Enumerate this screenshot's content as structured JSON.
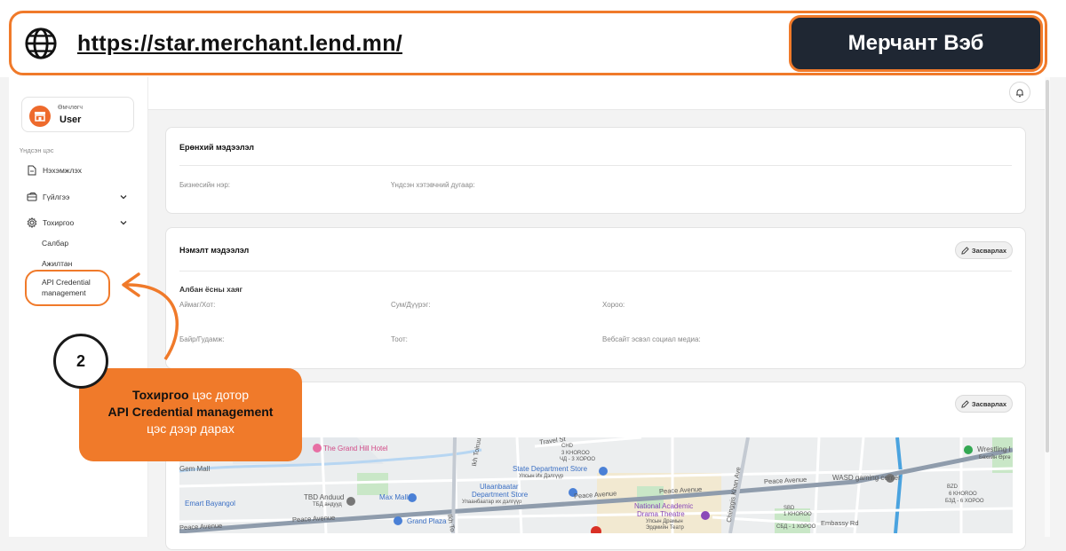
{
  "banner": {
    "url": "https://star.merchant.lend.mn/",
    "badge": "Мерчант Вэб"
  },
  "sidebar": {
    "user_role": "Өмчлөгч",
    "user_name": "User",
    "section": "Үндсэн цэс",
    "items": [
      {
        "label": "Нэхэмжлэх",
        "icon": "document-icon"
      },
      {
        "label": "Гүйлгээ",
        "icon": "wallet-icon"
      },
      {
        "label": "Тохиргоо",
        "icon": "gear-icon"
      }
    ],
    "sub_items": [
      "Салбар",
      "Ажилтан",
      "API Credential management"
    ]
  },
  "general_card": {
    "title": "Ерөнхий мэдээлэл",
    "business_name_label": "Бизнесийн нэр:",
    "registration_label": "Үндсэн хэтэвчний дугаар:"
  },
  "extra_card": {
    "title": "Нэмэлт мэдээлэл",
    "edit_label": "Засварлах",
    "address_title": "Албан ёсны хаяг",
    "province_label": "Аймаг/Хот:",
    "district_label": "Сум/Дүүрэг:",
    "khoroo_label": "Хороо:",
    "building_label": "Байр/Гудамж:",
    "door_label": "Тоот:",
    "website_label": "Вебсайт эсвэл социал медиа:"
  },
  "map_card": {
    "edit_label": "Засварлах",
    "labels": {
      "grand_hill": "The Grand Hill Hotel",
      "state_store": "State Department Store",
      "state_store_mn": "Улсын Их Дэлгүүр",
      "ulaanbaatar_store": "Ulaanbaatar",
      "ulaanbaatar_store2": "Department Store",
      "ulaanbaatar_store_mn": "Улаанбаатар их дэлгүүр",
      "gem_mall": "Gem Mall",
      "tbd": "TBD Anduud",
      "tbd_mn": "ТБД андууд",
      "max_mall": "Max Mall",
      "emart": "Emart Bayangol",
      "grand_plaza": "Grand Plaza",
      "national_theatre": "National Academic",
      "national_theatre2": "Drama Theatre",
      "national_theatre_mn": "Улсын Драмын",
      "national_theatre_mn2": "Эрдмийн Театр",
      "wasd": "WASD gaming center",
      "wrestling": "Wrestling I",
      "wrestling_mn": "Бөхийн Өргө",
      "embassy": "Embassy Rd",
      "travel": "Travel St",
      "peace1": "Peace Avenue",
      "peace2": "Peace Avenue",
      "peace3": "Peace Avenue",
      "peace4": "Peace Avenue",
      "peace5": "Peace Avenue",
      "ikh_toiruu": "Ikh Toiruu",
      "ikh_toiruu2": "Ikh To",
      "chingis": "Chinggis Khan Ave",
      "k3": "3 KHOROO",
      "k3_mn": "ЧД - 3 ХОРОО",
      "chd": "ЧД",
      "chd2": "CHD",
      "k1": "1 KHOROO",
      "k1_mn": "СБД - 1 ХОРОО",
      "sbd": "SBD",
      "bzd": "BZD",
      "k6": "6 KHOROO",
      "k6_mn": "БЗД - 6 ХОРОО"
    }
  },
  "annotation": {
    "step": "2",
    "line1_bold": "Тохиргоо",
    "line1_rest": " цэс  дотор",
    "line2_bold": "API Credential management",
    "line3": "цэс дээр дарах"
  },
  "colors": {
    "accent": "#f07a2a",
    "dark": "#1f2733"
  }
}
